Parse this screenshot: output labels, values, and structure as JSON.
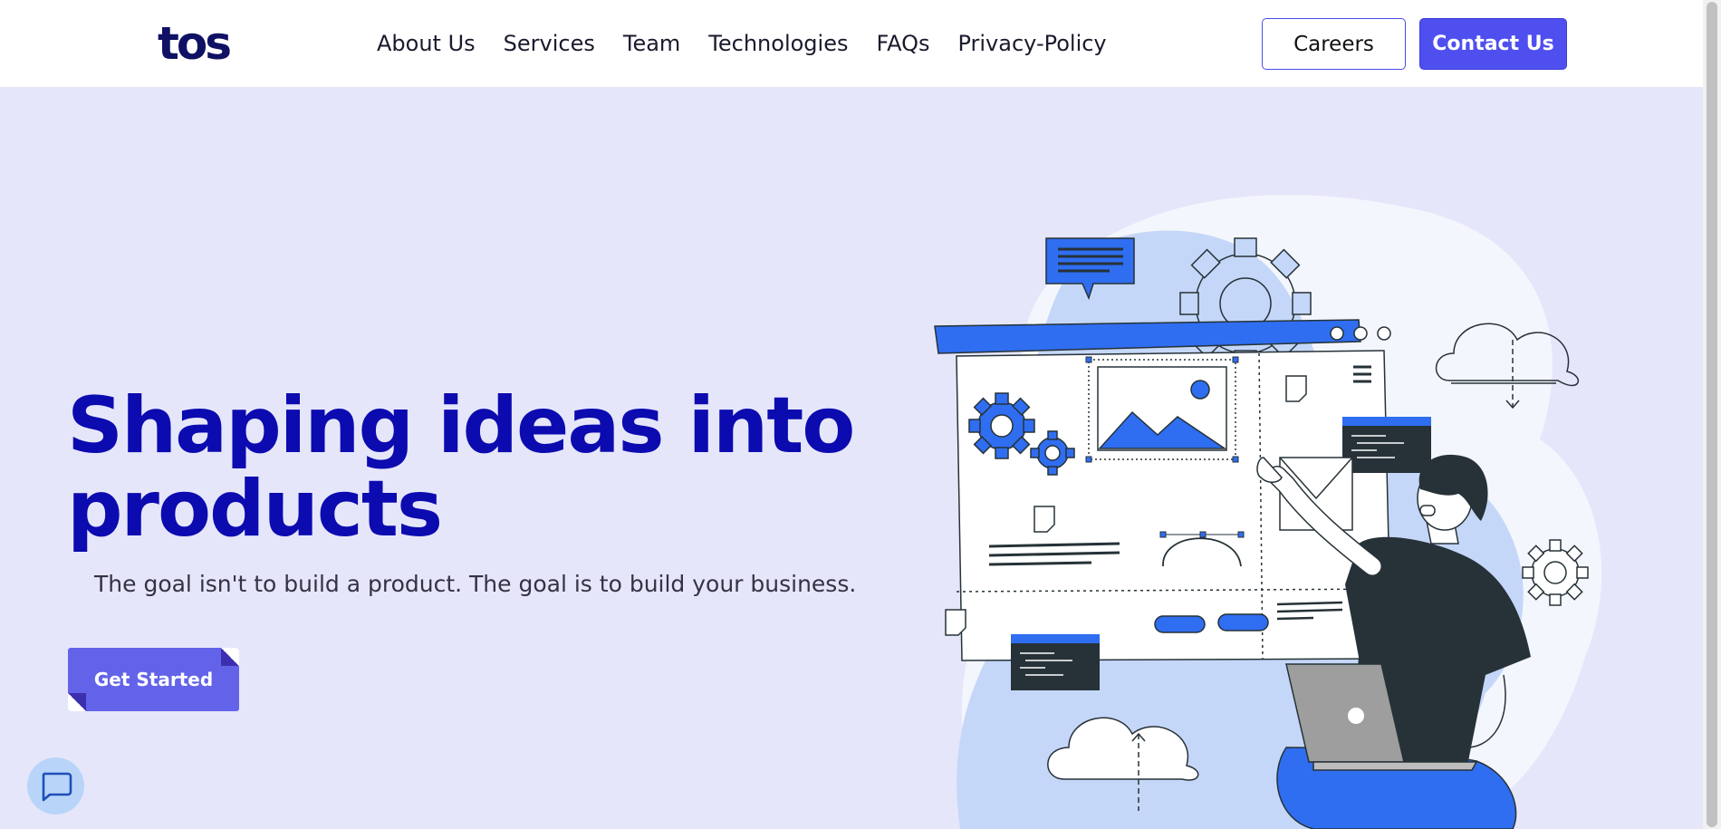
{
  "header": {
    "logo": "tos",
    "nav": [
      "About Us",
      "Services",
      "Team",
      "Technologies",
      "FAQs",
      "Privacy-Policy"
    ],
    "careers_label": "Careers",
    "contact_label": "Contact Us"
  },
  "hero": {
    "title_line1": "Shaping ideas into",
    "title_line2": "products",
    "subtitle": "The goal isn't to build a product. The goal is to build your business.",
    "cta_label": "Get Started"
  },
  "colors": {
    "background": "#e6e6fb",
    "brand_blue": "#4f4ff0",
    "title_blue": "#0b0bb0",
    "illustration_blue": "#2f6ef0",
    "chat_fab": "#b8d4f8"
  },
  "icons": {
    "chat": "chat-bubble-icon"
  }
}
